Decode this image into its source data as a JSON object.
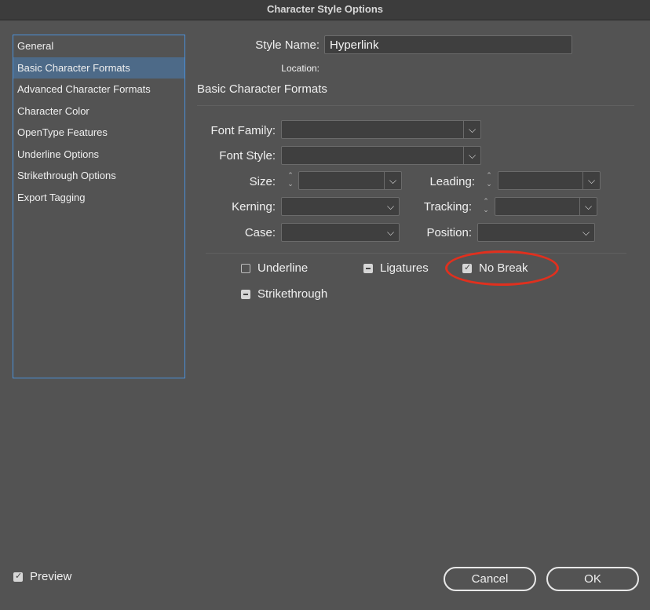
{
  "window": {
    "title": "Character Style Options"
  },
  "sidebar": {
    "items": [
      {
        "label": "General"
      },
      {
        "label": "Basic Character Formats",
        "selected": true
      },
      {
        "label": "Advanced Character Formats"
      },
      {
        "label": "Character Color"
      },
      {
        "label": "OpenType Features"
      },
      {
        "label": "Underline Options"
      },
      {
        "label": "Strikethrough Options"
      },
      {
        "label": "Export Tagging"
      }
    ]
  },
  "style": {
    "name_label": "Style Name:",
    "name_value": "Hyperlink",
    "location_label": "Location:"
  },
  "section": {
    "title": "Basic Character Formats"
  },
  "fields": {
    "font_family": "Font Family:",
    "font_style": "Font Style:",
    "size": "Size:",
    "leading": "Leading:",
    "kerning": "Kerning:",
    "tracking": "Tracking:",
    "case": "Case:",
    "position": "Position:"
  },
  "checks": {
    "underline": {
      "label": "Underline",
      "state": "unchecked"
    },
    "ligatures": {
      "label": "Ligatures",
      "state": "mixed"
    },
    "no_break": {
      "label": "No Break",
      "state": "checked"
    },
    "strikethrough": {
      "label": "Strikethrough",
      "state": "mixed"
    }
  },
  "preview": {
    "label": "Preview",
    "checked": true
  },
  "buttons": {
    "cancel": "Cancel",
    "ok": "OK"
  },
  "annotation_color": "#e0301e"
}
